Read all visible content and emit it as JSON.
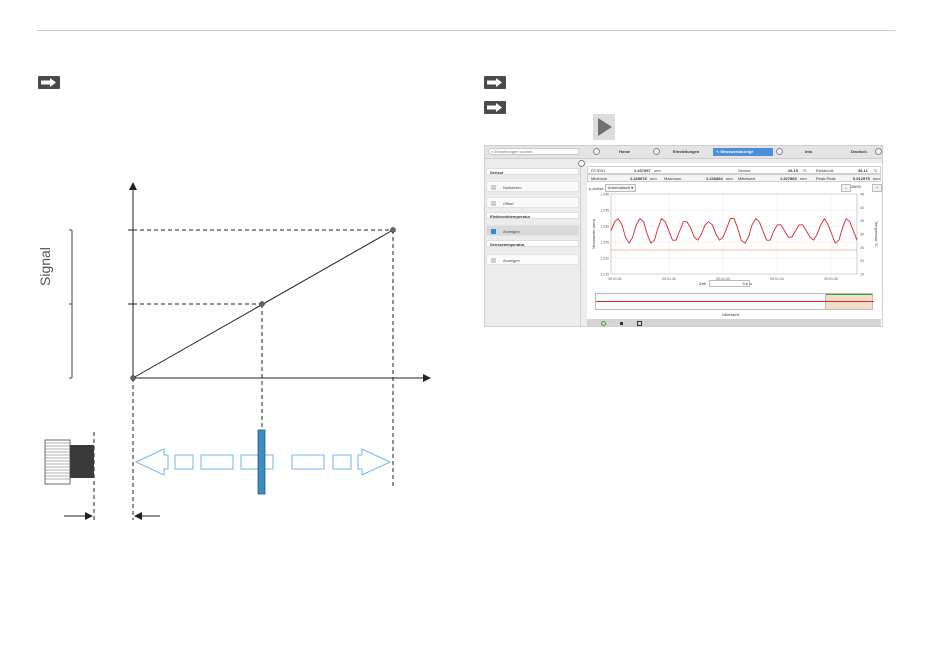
{
  "diagram": {
    "y_axis_label": "Signal"
  },
  "icons": {
    "arrow": "right-arrow-icon",
    "play": "play-icon"
  },
  "app": {
    "search_placeholder": "Einstellungen suchen",
    "nav": {
      "home": "Home",
      "settings": "Einstellungen",
      "measurement": "Messwertanzeige",
      "info": "Info",
      "language": "Deutsch"
    },
    "sidebar": {
      "sensor_title": "Sensor",
      "zero": "Nullsetzen",
      "offset": "Offset",
      "electronics_temp_title": "Elektroniktemperatur",
      "show_electronics": "Anzeigen",
      "sensor_temp_title": "Sensortemperatur",
      "show_sensor": "Anzeigen"
    },
    "values": {
      "device": "DT3001",
      "value": "1.237997",
      "value_unit": "mm",
      "sensor_label": "Sensor",
      "sensor_temp": "26.19",
      "temp_unit": "°C",
      "electronics_label": "Elektronik",
      "electronics_temp": "36.11",
      "min_label": "Minimum",
      "min_value": "1.229678",
      "max_label": "Maximum",
      "max_value": "1.236884",
      "mean_label": "Mittelwert",
      "mean_value": "1.227869",
      "pp_label": "Peak-Peak",
      "pp_value": "0.012975"
    },
    "controls": {
      "yaxis_label": "y-Achse",
      "yaxis_mode": "Automatisch",
      "zoom_minus": "–",
      "zoom": "280%",
      "zoom_plus": "+"
    },
    "colors": {
      "accent": "#4a8fd8",
      "signal": "#d9262e",
      "temp_line": "#e07a3a",
      "target": "#3d8bbf"
    },
    "chart_data": {
      "type": "line",
      "ylabel": "Messwerte (mm)",
      "y2label": "Temperatur °C",
      "xlabel": "Zeit",
      "time_input": "9,6",
      "time_unit": "s",
      "yticks": [
        "1.240",
        "1.235",
        "1.230",
        "1.225",
        "1.220",
        "1.216"
      ],
      "y2ticks": [
        "45",
        "40",
        "35",
        "30",
        "25",
        "20",
        "15"
      ],
      "xticks": [
        "00:01:31",
        "00:01:32",
        "00:01:33",
        "00:01:34",
        "00:01:35"
      ],
      "ylim": [
        1.216,
        1.242
      ],
      "series": [
        {
          "name": "",
          "values": [
            1.23,
            1.233,
            1.234,
            1.232,
            1.228,
            1.226,
            1.228,
            1.232,
            1.234,
            1.233,
            1.229,
            1.226,
            1.227,
            1.231,
            1.234,
            1.233,
            1.23,
            1.227,
            1.227,
            1.23,
            1.233,
            1.233,
            1.231,
            1.228,
            1.227,
            1.229,
            1.232,
            1.233,
            1.232,
            1.229,
            1.227,
            1.228,
            1.231,
            1.234,
            1.234,
            1.231,
            1.227,
            1.226,
            1.228,
            1.232,
            1.234,
            1.233,
            1.23,
            1.227,
            1.227,
            1.23,
            1.232,
            1.232,
            1.23,
            1.228,
            1.228,
            1.23,
            1.232,
            1.232,
            1.23,
            1.228,
            1.227,
            1.229,
            1.232,
            1.234,
            1.232,
            1.229,
            1.226,
            1.227,
            1.231,
            1.234,
            1.233,
            1.23,
            1.227
          ]
        }
      ],
      "overview_label": "Übersicht"
    }
  }
}
